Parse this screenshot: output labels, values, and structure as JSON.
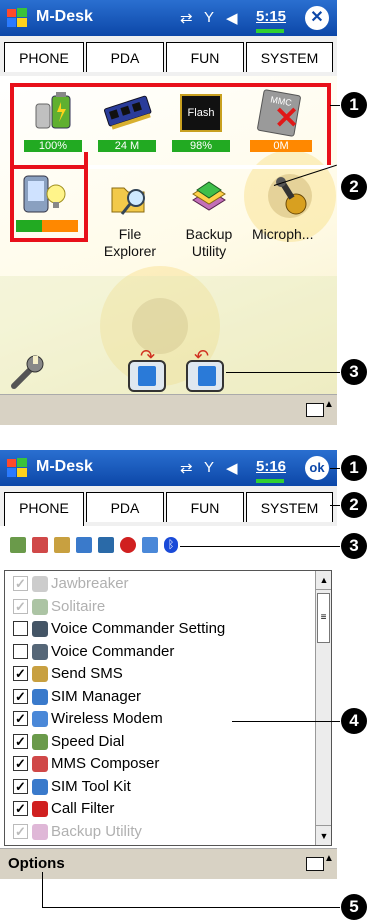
{
  "top": {
    "title": "M-Desk",
    "time": "5:15",
    "close_label": "✕",
    "tabs": [
      "PHONE",
      "PDA",
      "FUN",
      "SYSTEM"
    ],
    "tiles": [
      {
        "name": "battery",
        "value": "100%",
        "bar_color": "#22aa22"
      },
      {
        "name": "memory",
        "value": "24 M",
        "bar_color": "#22aa22"
      },
      {
        "name": "flash",
        "value": "98%",
        "bar_color": "#22aa22",
        "chip_text": "Flash"
      },
      {
        "name": "mmc",
        "value": "0M",
        "bar_color": "#ff8800",
        "chip_text": "MMC"
      }
    ],
    "apps": [
      {
        "label": "File Explorer"
      },
      {
        "label": "Backup Utility"
      },
      {
        "label": "Microph..."
      }
    ],
    "callouts": [
      "1",
      "2",
      "3"
    ]
  },
  "bottom": {
    "title": "M-Desk",
    "time": "5:16",
    "ok_label": "ok",
    "tabs": [
      "PHONE",
      "PDA",
      "FUN",
      "SYSTEM"
    ],
    "list": [
      {
        "label": "Jawbreaker",
        "checked": true,
        "dim": true,
        "icon_color": "#9a9a9a"
      },
      {
        "label": "Solitaire",
        "checked": true,
        "dim": true,
        "icon_color": "#5a8a4a"
      },
      {
        "label": "Voice Commander Setting",
        "checked": false,
        "dim": false,
        "icon_color": "#445566"
      },
      {
        "label": "Voice Commander",
        "checked": false,
        "dim": false,
        "icon_color": "#556677"
      },
      {
        "label": "Send SMS",
        "checked": true,
        "dim": false,
        "icon_color": "#c8a040"
      },
      {
        "label": "SIM Manager",
        "checked": true,
        "dim": false,
        "icon_color": "#3a7acb"
      },
      {
        "label": "Wireless Modem",
        "checked": true,
        "dim": false,
        "icon_color": "#4a88d8"
      },
      {
        "label": "Speed Dial",
        "checked": true,
        "dim": false,
        "icon_color": "#6a9a4a"
      },
      {
        "label": "MMS Composer",
        "checked": true,
        "dim": false,
        "icon_color": "#d04848"
      },
      {
        "label": "SIM Tool Kit",
        "checked": true,
        "dim": false,
        "icon_color": "#3a7acb"
      },
      {
        "label": "Call Filter",
        "checked": true,
        "dim": false,
        "icon_color": "#d02020"
      },
      {
        "label": "Backup Utility",
        "checked": true,
        "dim": true,
        "icon_color": "#c06fb0"
      }
    ],
    "options_label": "Options",
    "callouts": [
      "1",
      "2",
      "3",
      "4",
      "5"
    ]
  }
}
